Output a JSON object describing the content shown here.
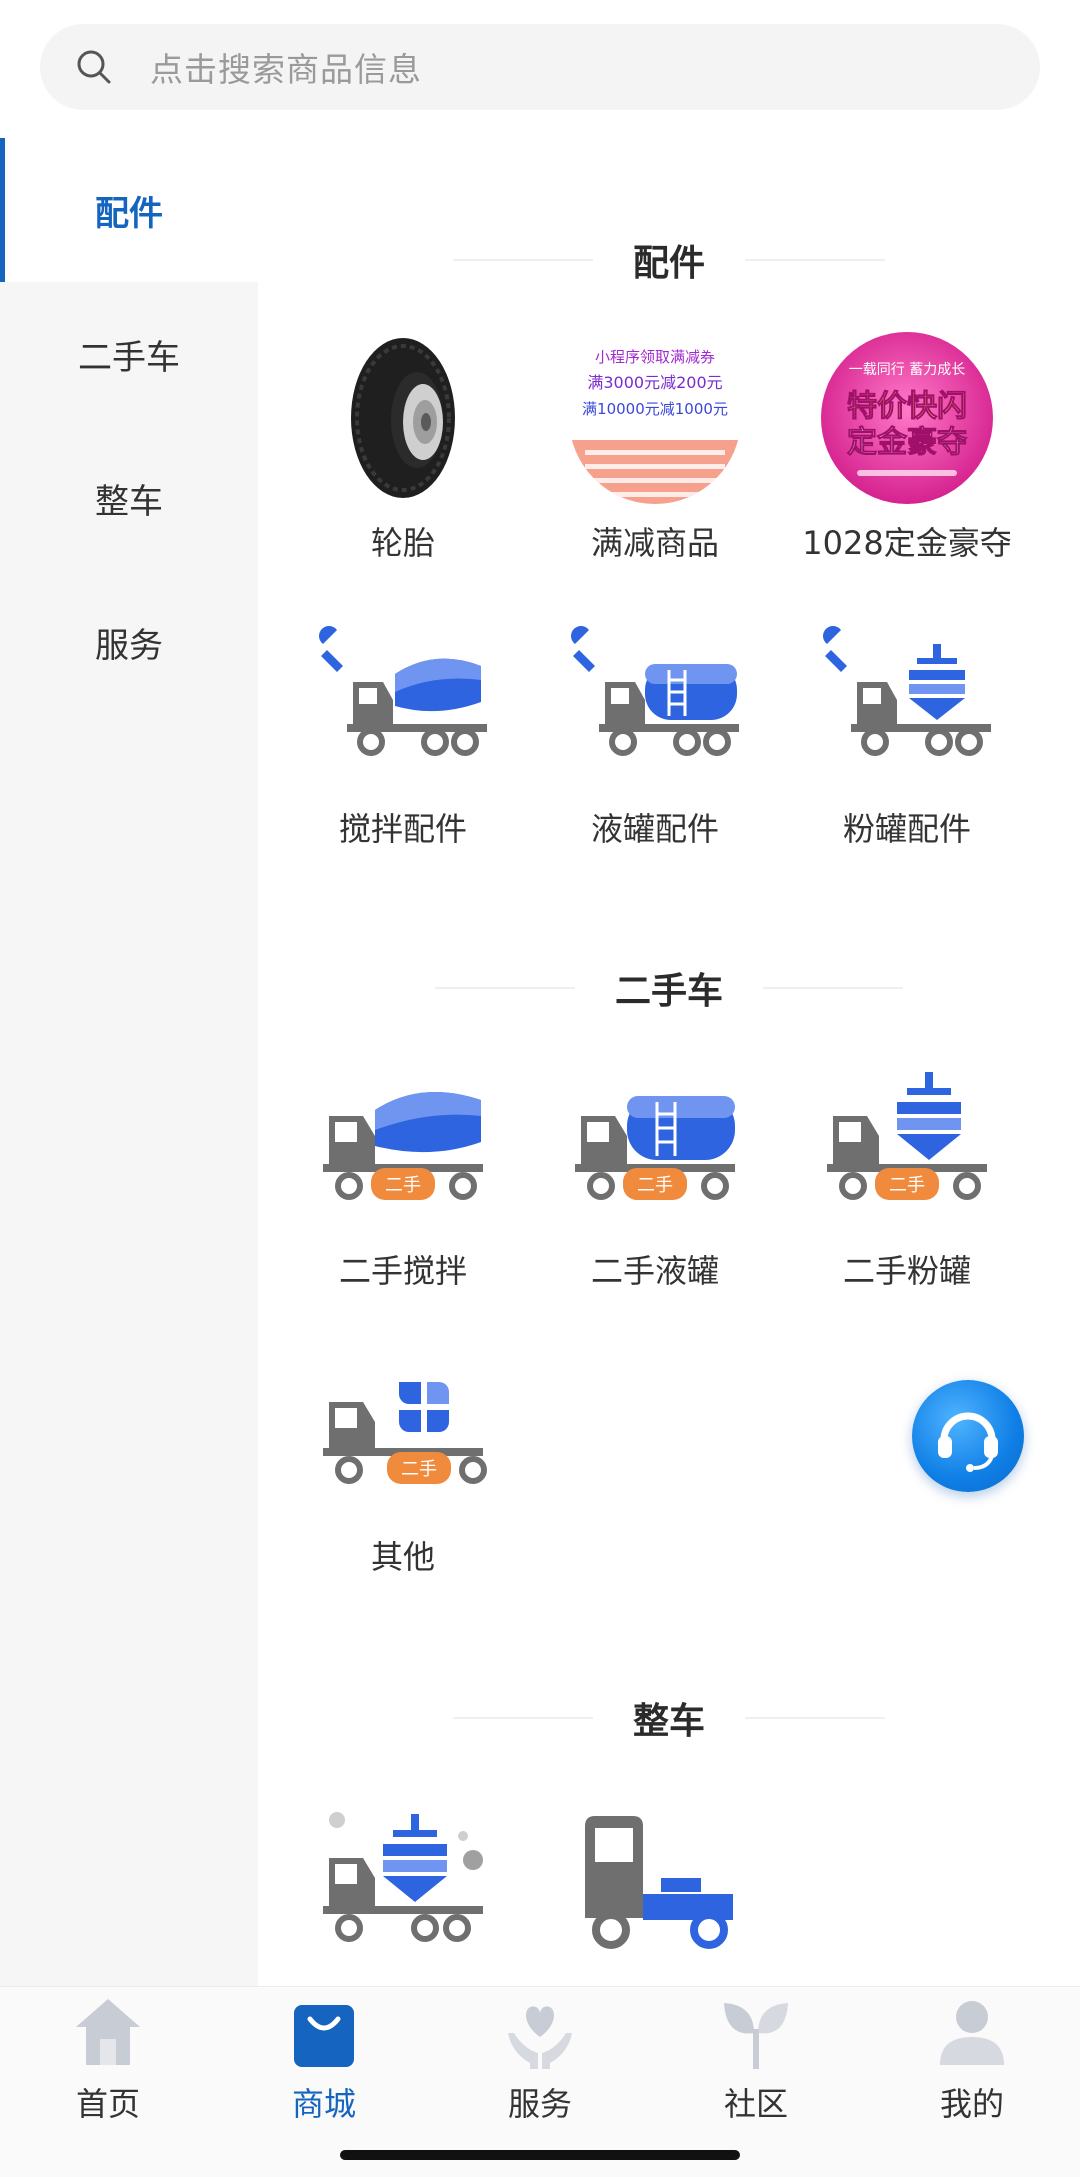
{
  "search": {
    "placeholder": "点击搜索商品信息"
  },
  "sidebar": {
    "items": [
      {
        "label": "配件",
        "active": true
      },
      {
        "label": "二手车",
        "active": false
      },
      {
        "label": "整车",
        "active": false
      },
      {
        "label": "服务",
        "active": false
      }
    ]
  },
  "sections": {
    "parts": {
      "title": "配件",
      "items": [
        {
          "label": "轮胎",
          "icon": "tire-image"
        },
        {
          "label": "满减商品",
          "icon": "discount-promo-image"
        },
        {
          "label": "1028定金豪夺",
          "icon": "flash-sale-promo-image"
        },
        {
          "label": "搅拌配件",
          "icon": "mixer-parts-icon"
        },
        {
          "label": "液罐配件",
          "icon": "liquid-tank-parts-icon"
        },
        {
          "label": "粉罐配件",
          "icon": "powder-tank-parts-icon"
        }
      ]
    },
    "used": {
      "title": "二手车",
      "badge": "二手",
      "items": [
        {
          "label": "二手搅拌",
          "icon": "used-mixer-truck-icon"
        },
        {
          "label": "二手液罐",
          "icon": "used-liquid-tank-truck-icon"
        },
        {
          "label": "二手粉罐",
          "icon": "used-powder-tank-truck-icon"
        },
        {
          "label": "其他",
          "icon": "used-other-truck-icon"
        }
      ]
    },
    "whole": {
      "title": "整车",
      "items": [
        {
          "icon": "powder-tank-truck-icon"
        },
        {
          "icon": "tractor-truck-icon"
        }
      ]
    }
  },
  "promo": {
    "discount_lines": [
      "小程序领取满减券",
      "满3000元减200元",
      "满10000元减1000元"
    ],
    "flash_lines": [
      "一载同行 蓄力成长",
      "特价快闪",
      "定金豪夺"
    ]
  },
  "tabs": [
    {
      "label": "首页",
      "icon": "home-icon",
      "active": false
    },
    {
      "label": "商城",
      "icon": "shopping-bag-icon",
      "active": true
    },
    {
      "label": "服务",
      "icon": "heart-hands-icon",
      "active": false
    },
    {
      "label": "社区",
      "icon": "sprout-icon",
      "active": false
    },
    {
      "label": "我的",
      "icon": "person-icon",
      "active": false
    }
  ],
  "colors": {
    "brand_blue": "#1565c0",
    "truck_blue": "#2f64e0",
    "truck_gray": "#6f6f6f",
    "badge_orange": "#f08a3c",
    "sidebar_bg": "#f6f6f7"
  }
}
